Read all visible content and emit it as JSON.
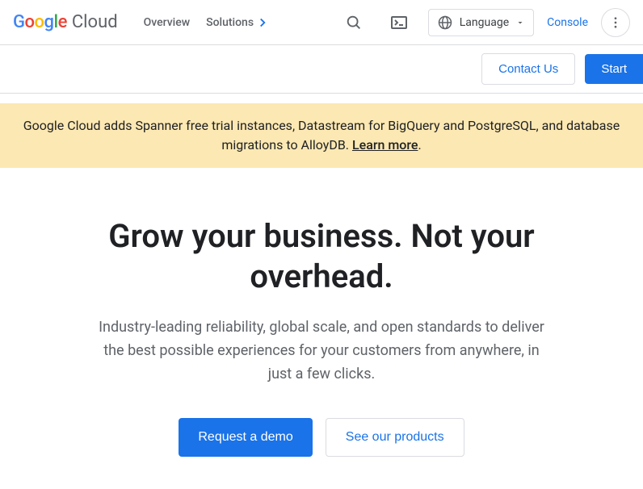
{
  "header": {
    "logo_main": "Google",
    "logo_sub": "Cloud",
    "nav": {
      "overview": "Overview",
      "solutions": "Solutions"
    },
    "language_label": "Language",
    "console_link": "Console"
  },
  "subnav": {
    "contact": "Contact Us",
    "start": "Start"
  },
  "banner": {
    "text": "Google Cloud adds Spanner free trial instances, Datastream for BigQuery and PostgreSQL, and database migrations to AlloyDB. ",
    "link": "Learn more",
    "period": "."
  },
  "hero": {
    "title": "Grow your business. Not your overhead.",
    "subtitle": "Industry-leading reliability, global scale, and open standards to deliver the best possible experiences for your customers from anywhere, in just a few clicks.",
    "cta_primary": "Request a demo",
    "cta_secondary": "See our products"
  }
}
